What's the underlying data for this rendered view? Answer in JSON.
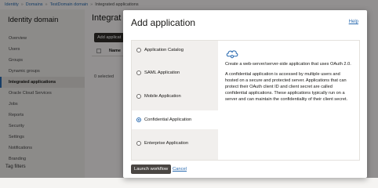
{
  "breadcrumb": [
    "Identity",
    "Domains",
    "TestDomain domain",
    "Integrated applications"
  ],
  "sidebar": {
    "title": "Identity domain",
    "items": [
      {
        "label": "Overview"
      },
      {
        "label": "Users"
      },
      {
        "label": "Groups"
      },
      {
        "label": "Dynamic groups"
      },
      {
        "label": "Integrated applications",
        "active": true
      },
      {
        "label": "Oracle Cloud Services"
      },
      {
        "label": "Jobs"
      },
      {
        "label": "Reports"
      },
      {
        "label": "Security"
      },
      {
        "label": "Settings"
      },
      {
        "label": "Notifications"
      },
      {
        "label": "Branding"
      }
    ],
    "section_label": "Tag filters"
  },
  "main": {
    "title_partial": "Integrat",
    "add_button": "Add applicat",
    "table_header_name": "Name",
    "selected_text": "0 selected"
  },
  "dialog": {
    "title": "Add application",
    "help_link": "Help",
    "options": [
      {
        "label": "Application Catalog",
        "selected": false
      },
      {
        "label": "SAML Application",
        "selected": false
      },
      {
        "label": "Mobile Application",
        "selected": false
      },
      {
        "label": "Confidential Application",
        "selected": true
      },
      {
        "label": "Enterprise Application",
        "selected": false
      }
    ],
    "detail_icon": "cloud-gear-icon",
    "detail_heading": "Create a web-server/server-side application that uses OAuth 2.0.",
    "detail_text": "A confidential application is accessed by multiple users and hosted on a secure and protected server. Applications that can protect their OAuth client ID and client secret are called confidential applications. These applications typically run on a server and can maintain the confidentiality of their client secret.",
    "launch_button": "Launch workflow",
    "cancel_link": "Cancel"
  },
  "colors": {
    "accent": "#2a6bb0",
    "primary_button": "#4a4643"
  }
}
